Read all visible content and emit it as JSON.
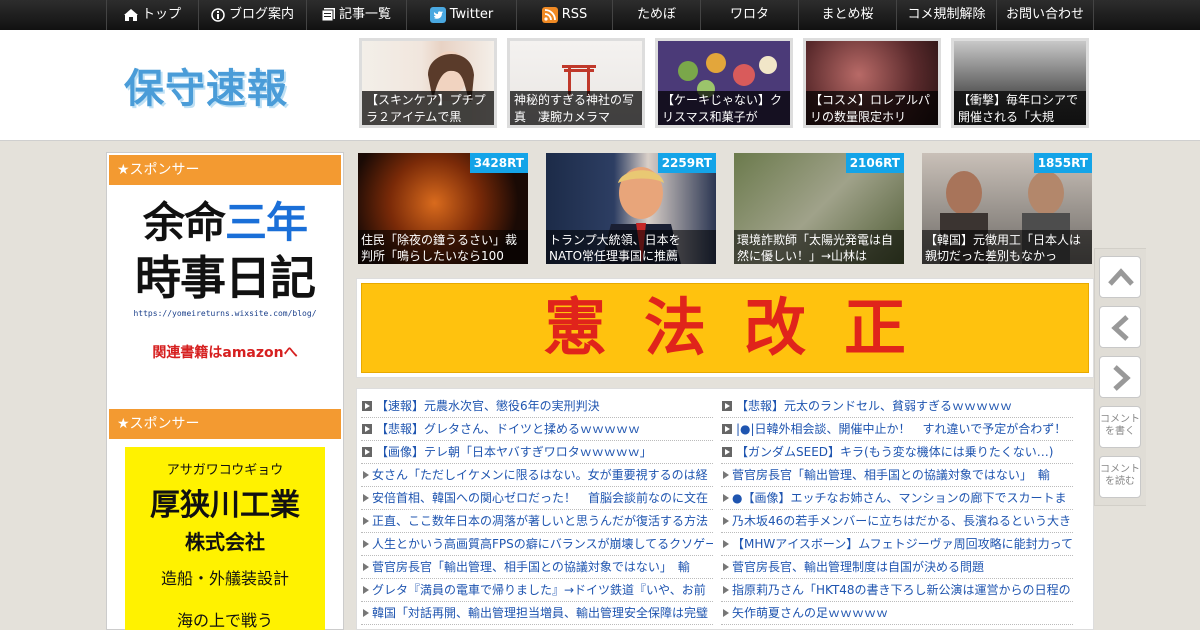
{
  "nav": {
    "items": [
      {
        "label": "トップ",
        "icon": "home-icon"
      },
      {
        "label": "ブログ案内",
        "icon": "info-icon"
      },
      {
        "label": "記事一覧",
        "icon": "list-icon"
      },
      {
        "label": "Twitter",
        "icon": "twitter-icon"
      },
      {
        "label": "RSS",
        "icon": "rss-icon"
      },
      {
        "label": "ためぼ"
      },
      {
        "label": "ワロタ"
      },
      {
        "label": "まとめ桜"
      },
      {
        "label": "コメ規制解除"
      },
      {
        "label": "お問い合わせ"
      }
    ]
  },
  "header": {
    "logo_text": "保守速報",
    "thumbs": [
      {
        "caption": "【スキンケア】プチプラ２アイテムで黒"
      },
      {
        "caption": "神秘的すぎる神社の写真　凄腕カメラマ"
      },
      {
        "caption": "【ケーキじゃない】クリスマス和菓子が"
      },
      {
        "caption": "【コスメ】ロレアルパリの数量限定ホリ"
      },
      {
        "caption": "【衝撃】毎年ロシアで開催される「大規"
      }
    ]
  },
  "sidebar": {
    "sponsor_title_1": "★スポンサー",
    "ad1": {
      "line1a": "余命",
      "line1b": "三年",
      "line2": "時事日記",
      "url": "https://yomeireturns.wixsite.com/blog/",
      "link": "関連書籍はamazonへ"
    },
    "sponsor_title_2": "★スポンサー",
    "ad2": {
      "kana": "アサガワコウギョウ",
      "name": "厚狭川工業",
      "corp": "株式会社",
      "business": "造船・外艤装設計",
      "footer": "海の上で戦う"
    }
  },
  "trending": [
    {
      "rt": "3428RT",
      "caption": "住民「除夜の鐘うるさい」裁判所「鳴らしたいなら100"
    },
    {
      "rt": "2259RT",
      "caption": "トランプ大統領、日本をNATO常任理事国に推薦"
    },
    {
      "rt": "2106RT",
      "caption": "環境詐欺師「太陽光発電は自然に優しい！」→山林は"
    },
    {
      "rt": "1855RT",
      "caption": "【韓国】元徴用工「日本人は親切だった差別もなかっ"
    }
  ],
  "banner": {
    "text": "憲法改正"
  },
  "articles": {
    "left": [
      {
        "t": "【速報】元農水次官、懲役6年の実刑判決",
        "bullet": "box"
      },
      {
        "t": "【悲報】グレタさん、ドイツと揉めるｗｗｗｗｗ",
        "bullet": "box"
      },
      {
        "t": "【画像】テレ朝「日本ヤバすぎワロタｗｗｗｗｗ」",
        "bullet": "box"
      },
      {
        "t": "女さん「ただしイケメンに限るはない。女が重要視するのは経",
        "bullet": "tri"
      },
      {
        "t": "安倍首相、韓国への関心ゼロだった！　首脳会談前なのに文在",
        "bullet": "tri"
      },
      {
        "t": "正直、ここ数年日本の凋落が著しいと思うんだが復活する方法",
        "bullet": "tri"
      },
      {
        "t": "人生とかいう高画質高FPSの癖にバランスが崩壊してるクソゲー",
        "bullet": "tri"
      },
      {
        "t": "菅官房長官「輸出管理、相手国との協議対象ではない」　輸",
        "bullet": "tri"
      },
      {
        "t": "グレタ『満員の電車で帰りました』→ドイツ鉄道『いや、お前",
        "bullet": "tri"
      },
      {
        "t": "韓国「対話再開、輸出管理担当増員、輸出管理安全保障は完璧",
        "bullet": "tri"
      }
    ],
    "right": [
      {
        "t": "【悲報】元太のランドセル、貧弱すぎるｗｗｗｗｗ",
        "bullet": "box"
      },
      {
        "t": "|●|日韓外相会談、開催中止か！　すれ違いで予定が合わず！",
        "bullet": "box"
      },
      {
        "t": "【ガンダムSEED】キラ(もう変な機体には乗りたくない…)",
        "bullet": "box"
      },
      {
        "t": "菅官房長官「輸出管理、相手国との協議対象ではない」　輸",
        "bullet": "tri"
      },
      {
        "t": "●【画像】エッチなお姉さん、マンションの廊下でスカートま",
        "bullet": "tri"
      },
      {
        "t": "乃木坂46の若手メンバーに立ちはだかる、長濱ねるという大き",
        "bullet": "tri"
      },
      {
        "t": "【MHWアイスボーン】ムフェトジーヴァ周回攻略に能封力って",
        "bullet": "tri"
      },
      {
        "t": "菅官房長官、輸出管理制度は自国が決める問題",
        "bullet": "tri"
      },
      {
        "t": "指原莉乃さん「HKT48の書き下ろし新公演は運営からの日程の",
        "bullet": "tri"
      },
      {
        "t": "矢作萌夏さんの足ｗｗｗｗｗ",
        "bullet": "tri"
      }
    ]
  },
  "side_buttons": {
    "comment_write": "コメントを書く",
    "comment_read": "コメントを読む"
  },
  "colors": {
    "accent": "#f39a31",
    "link": "#1f55b0",
    "rt_badge": "#14a4e8",
    "banner_bg": "#ffc20e",
    "banner_text": "#e0241b"
  }
}
